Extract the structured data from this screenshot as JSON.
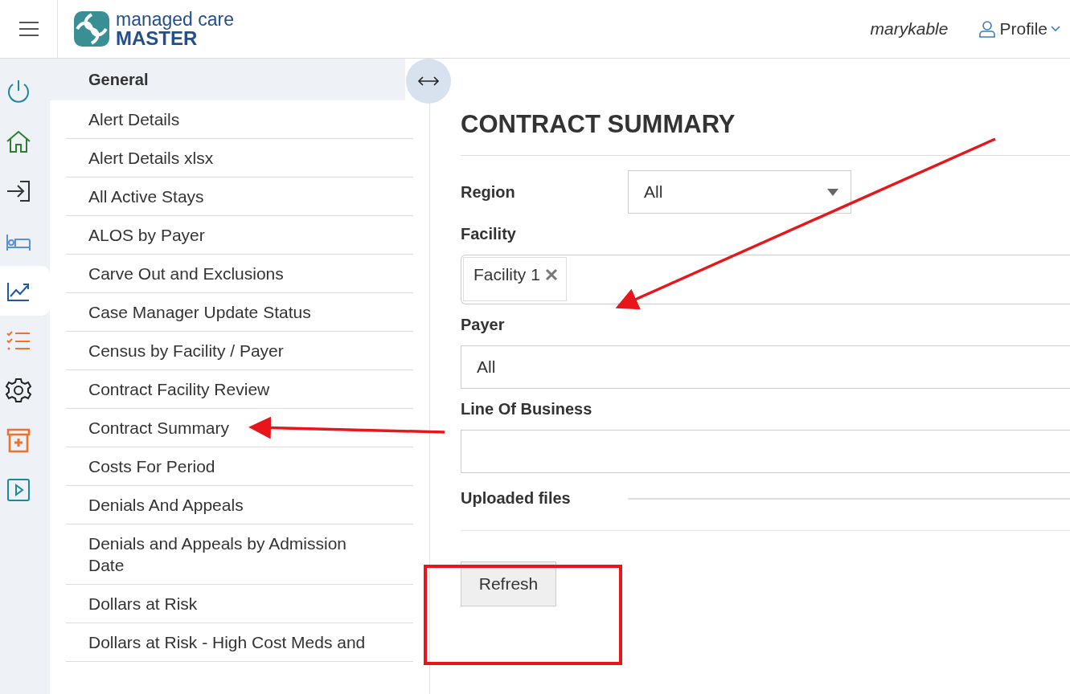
{
  "header": {
    "brand_top": "managed care",
    "brand_bottom": "MASTER",
    "username": "marykable",
    "profile": "Profile"
  },
  "rail": [
    {
      "kind": "power",
      "selected": false
    },
    {
      "kind": "home",
      "selected": false
    },
    {
      "kind": "login",
      "selected": false
    },
    {
      "kind": "bed",
      "selected": false
    },
    {
      "kind": "chart",
      "selected": true
    },
    {
      "kind": "tasks",
      "selected": false
    },
    {
      "kind": "settings",
      "selected": false
    },
    {
      "kind": "kit",
      "selected": false
    },
    {
      "kind": "play",
      "selected": false
    }
  ],
  "menu": {
    "section": "General",
    "items": [
      "Alert Details",
      "Alert Details xlsx",
      "All Active Stays",
      "ALOS by Payer",
      "Carve Out and Exclusions",
      "Case Manager Update Status",
      "Census by Facility / Payer",
      "Contract Facility Review",
      "Contract Summary",
      "Costs For Period",
      "Denials And Appeals",
      "Denials and Appeals by Admission Date",
      "Dollars at Risk",
      "Dollars at Risk - High Cost Meds and"
    ]
  },
  "content": {
    "title": "CONTRACT SUMMARY",
    "fields": [
      {
        "kind": "select",
        "label": "Region",
        "value": "All"
      },
      {
        "kind": "tags",
        "label": "Facility",
        "tags": [
          "Facility 1"
        ]
      },
      {
        "kind": "text",
        "label": "Payer",
        "value": "All"
      },
      {
        "kind": "text",
        "label": "Line Of Business"
      },
      {
        "kind": "files",
        "label": "Uploaded files"
      }
    ],
    "button": "Refresh"
  },
  "annotations": [
    {
      "kind": "arrow"
    },
    {
      "kind": "arrow"
    },
    {
      "kind": "frame"
    }
  ]
}
